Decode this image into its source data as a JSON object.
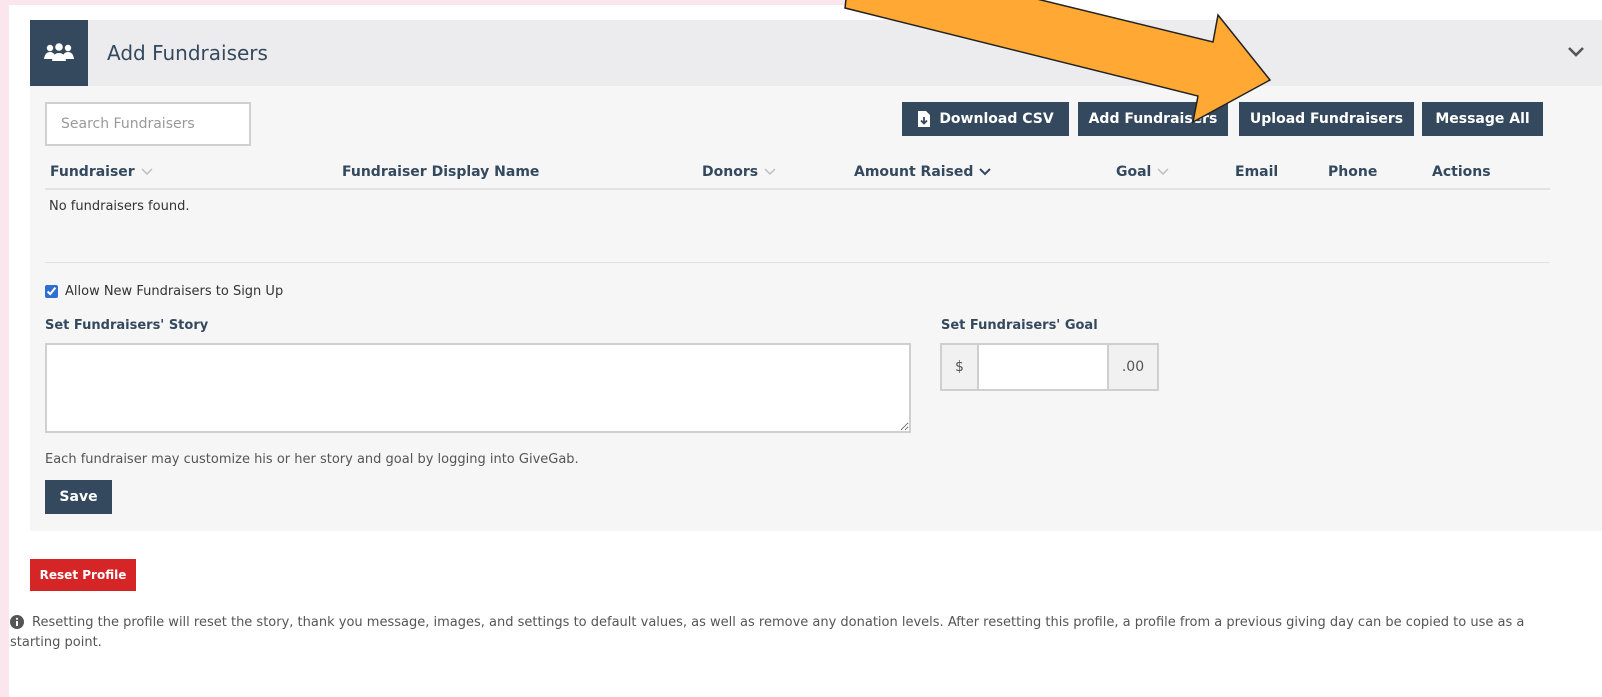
{
  "panel": {
    "title": "Add Fundraisers",
    "header_icon": "users-group-icon",
    "collapse_icon": "chevron-down-icon"
  },
  "toolbar": {
    "search_placeholder": "Search Fundraisers",
    "search_value": "",
    "download_csv_label": "Download CSV",
    "download_icon": "file-download-icon",
    "add_fundraisers_label": "Add Fundraisers",
    "upload_fundraisers_label": "Upload Fundraisers",
    "message_all_label": "Message All"
  },
  "table": {
    "columns": [
      {
        "label": "Fundraiser",
        "sort": "inactive"
      },
      {
        "label": "Fundraiser Display Name",
        "sort": "none"
      },
      {
        "label": "Donors",
        "sort": "inactive"
      },
      {
        "label": "Amount Raised",
        "sort": "active"
      },
      {
        "label": "Goal",
        "sort": "inactive"
      },
      {
        "label": "Email",
        "sort": "none"
      },
      {
        "label": "Phone",
        "sort": "none"
      },
      {
        "label": "Actions",
        "sort": "none"
      }
    ],
    "empty_message": "No fundraisers found."
  },
  "settings": {
    "allow_signup_label": "Allow New Fundraisers to Sign Up",
    "allow_signup_checked": true,
    "story_label": "Set Fundraisers' Story",
    "story_value": "",
    "goal_label": "Set Fundraisers' Goal",
    "goal_prefix": "$",
    "goal_value": "",
    "goal_suffix": ".00",
    "help_text": "Each fundraiser may customize his or her story and goal by logging into GiveGab.",
    "save_label": "Save"
  },
  "reset": {
    "button_label": "Reset Profile",
    "info_icon": "info-circle-icon",
    "info_text": "Resetting the profile will reset the story, thank you message, images, and settings to default values, as well as remove any donation levels. After resetting this profile, a profile from a previous giving day can be copied to use as a starting point."
  },
  "annotation": {
    "arrow_color": "#ffa833",
    "arrow_target": "upload-fundraisers-button"
  },
  "colors": {
    "primary": "#34495e",
    "danger": "#d62527",
    "panel_header_bg": "#ececee",
    "panel_body_bg": "#f6f6f7",
    "page_accent": "#fbe6ee"
  }
}
